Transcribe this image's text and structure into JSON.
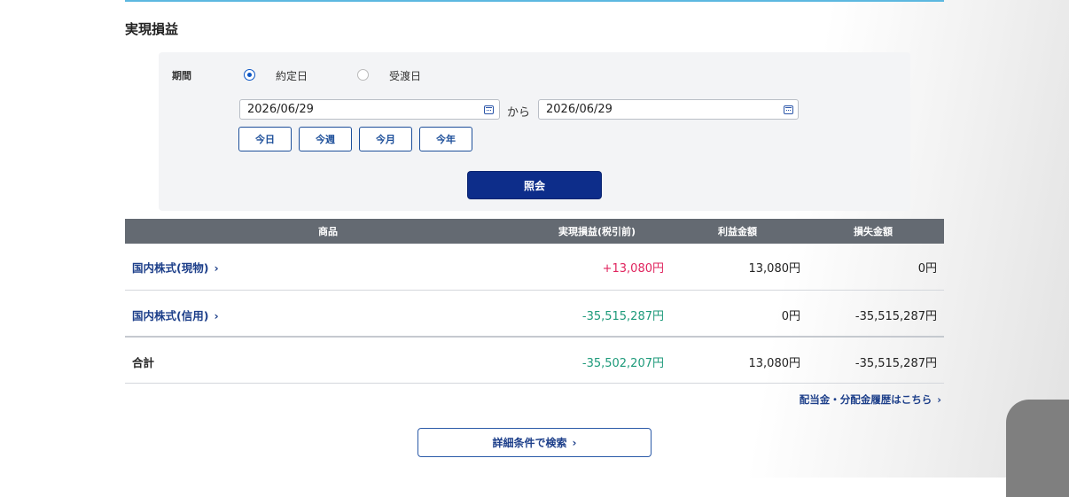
{
  "section_title": "実現損益",
  "search": {
    "period_label": "期間",
    "radio_options": [
      {
        "label": "約定日",
        "selected": true
      },
      {
        "label": "受渡日",
        "selected": false
      }
    ],
    "date_from": "2026/06/29",
    "date_to": "2026/06/29",
    "range_sep": "から",
    "quick_buttons": [
      "今日",
      "今週",
      "今月",
      "今年"
    ],
    "submit_label": "照会"
  },
  "table": {
    "headers": [
      "商品",
      "実現損益(税引前)",
      "利益金額",
      "損失金額"
    ],
    "rows": [
      {
        "name": "国内株式(現物)",
        "realized": "+13,080円",
        "profit": "13,080円",
        "loss": "0円"
      },
      {
        "name": "国内株式(信用)",
        "realized": "-35,515,287円",
        "profit": "0円",
        "loss": "-35,515,287円"
      }
    ],
    "total": {
      "label": "合計",
      "realized": "-35,502,207円",
      "profit": "13,080円",
      "loss": "-35,515,287円"
    }
  },
  "history_link": "配当金・分配金履歴はこちら",
  "detail_search_label": "詳細条件で検索",
  "icons": {
    "calendar": "calendar-icon",
    "chevron": "chevron-right-icon"
  },
  "colors": {
    "positive": "#e0245e",
    "negative": "#1d9a7a",
    "primary": "#0d2d8a",
    "link": "#1d3f8a"
  }
}
